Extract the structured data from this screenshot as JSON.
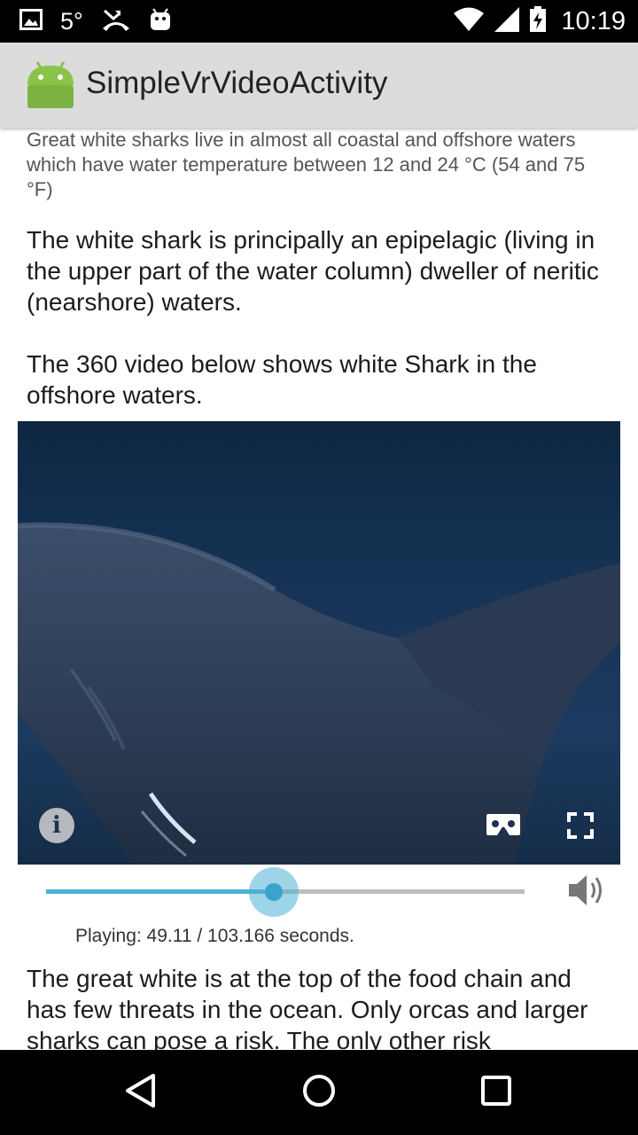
{
  "status_bar": {
    "temperature": "5°",
    "time": "10:19",
    "icons": [
      "image-notification-icon",
      "missed-call-icon",
      "android-debug-icon",
      "wifi-icon",
      "signal-icon",
      "battery-charging-icon"
    ]
  },
  "app_bar": {
    "title": "SimpleVrVideoActivity",
    "icon": "android-robot-icon",
    "background": "#dcdcdc"
  },
  "content": {
    "paragraph_small": "Great white sharks live in almost all coastal and offshore waters which have water temperature between 12 and 24 °C (54 and 75 °F)",
    "paragraph_1": "The white shark is principally an epipelagic (living in the upper part of the water column) dweller of neritic (nearshore) waters.",
    "paragraph_2": "The 360 video below shows white Shark in the offshore waters.",
    "video": {
      "info_label": "i",
      "controls": [
        "info-icon",
        "cardboard-vr-icon",
        "fullscreen-icon"
      ]
    },
    "playback": {
      "progress_fraction": 0.476,
      "status_text": "Playing: 49.11 / 103.166 seconds.",
      "accent_color": "#4fb0d5"
    },
    "paragraph_3": "The great white is at the top of the food chain and has few threats in the ocean. Only orcas and larger sharks can pose a risk. The only other risk"
  },
  "nav_bar": {
    "buttons": [
      "back-icon",
      "home-icon",
      "recents-icon"
    ]
  }
}
